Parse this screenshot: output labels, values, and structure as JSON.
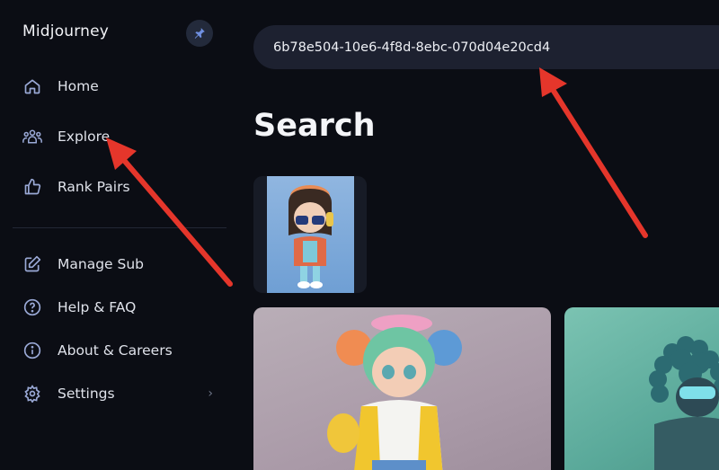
{
  "brand": {
    "name": "Midjourney"
  },
  "sidebar": {
    "primary": [
      {
        "label": "Home",
        "icon": "home-icon"
      },
      {
        "label": "Explore",
        "icon": "people-icon"
      },
      {
        "label": "Rank Pairs",
        "icon": "thumbs-up-icon"
      }
    ],
    "secondary": [
      {
        "label": "Manage Sub",
        "icon": "edit-icon"
      },
      {
        "label": "Help & FAQ",
        "icon": "help-icon"
      },
      {
        "label": "About & Careers",
        "icon": "info-icon"
      },
      {
        "label": "Settings",
        "icon": "gear-icon"
      }
    ]
  },
  "search": {
    "value": "6b78e504-10e6-4f8d-8ebc-070d04e20cd4"
  },
  "main": {
    "title": "Search"
  },
  "colors": {
    "background": "#0b0d14",
    "search_bg": "#1d2130",
    "icon_accent": "#9aa9d6",
    "annotation_arrow": "#e5362b"
  }
}
